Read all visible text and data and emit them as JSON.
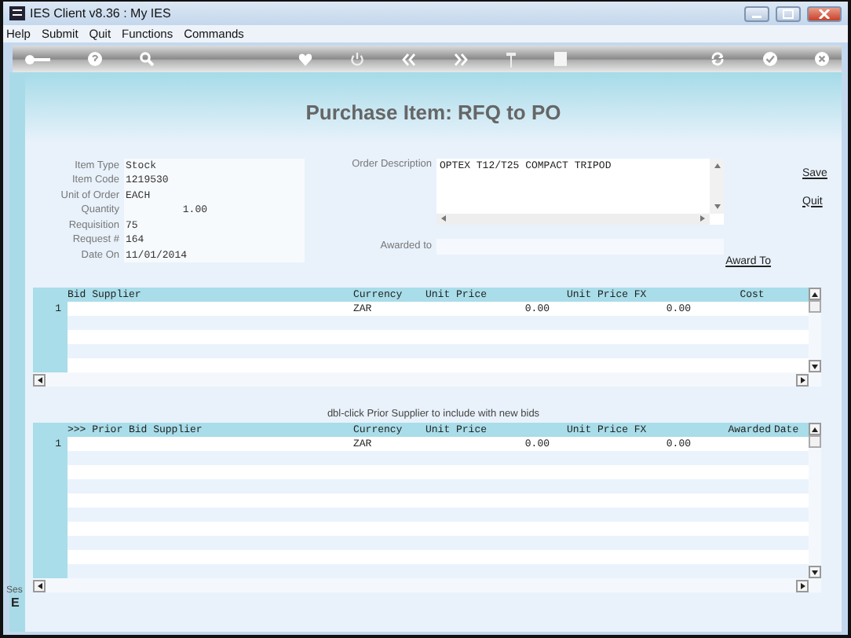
{
  "window": {
    "title": "IES Client v8.36 : My IES"
  },
  "menu": [
    "Help",
    "Submit",
    "Quit",
    "Functions",
    "Commands"
  ],
  "toolbar": [
    {
      "kind": "key"
    },
    {
      "kind": "help"
    },
    {
      "kind": "search"
    },
    {
      "kind": "heart"
    },
    {
      "kind": "power"
    },
    {
      "kind": "back"
    },
    {
      "kind": "forward"
    },
    {
      "kind": "pin"
    },
    {
      "kind": "square"
    },
    {
      "kind": "refresh"
    },
    {
      "kind": "check"
    },
    {
      "kind": "close"
    }
  ],
  "page_title": "Purchase Item: RFQ to PO",
  "fields": [
    {
      "label": "Item Type",
      "value": "Stock",
      "kind": "text"
    },
    {
      "label": "Item Code",
      "value": "1219530",
      "kind": "text"
    },
    {
      "label": "Unit of Order",
      "value": "EACH",
      "kind": "text"
    },
    {
      "label": "Quantity",
      "value": "1.00",
      "kind": "number"
    },
    {
      "label": "Requisition",
      "value": "75",
      "kind": "text"
    },
    {
      "label": "Request #",
      "value": "164",
      "kind": "text"
    },
    {
      "label": "Date On",
      "value": "11/01/2014",
      "kind": "text"
    }
  ],
  "order_description": {
    "label": "Order Description",
    "value": "OPTEX T12/T25 COMPACT TRIPOD"
  },
  "awarded_to": {
    "label": "Awarded to"
  },
  "links": [
    "Save",
    "Quit"
  ],
  "award_link": "Award To",
  "bid_grid": {
    "columns": [
      "Bid Supplier",
      "Currency",
      "Unit Price",
      "Unit Price FX",
      "Cost"
    ],
    "rows": [
      {
        "number": "1",
        "cells": [
          "",
          "ZAR",
          "0.00",
          "0.00",
          ""
        ]
      }
    ]
  },
  "hint": "dbl-click Prior Supplier to include with new bids",
  "prior_grid": {
    "columns": [
      ">>> Prior Bid Supplier",
      "Currency",
      "Unit Price",
      "Unit Price FX",
      "Awarded",
      "Date"
    ],
    "rows": [
      {
        "number": "1",
        "cells": [
          "",
          "ZAR",
          "0.00",
          "0.00",
          "",
          ""
        ]
      }
    ]
  },
  "side_texts": [
    "Ses",
    "E"
  ]
}
